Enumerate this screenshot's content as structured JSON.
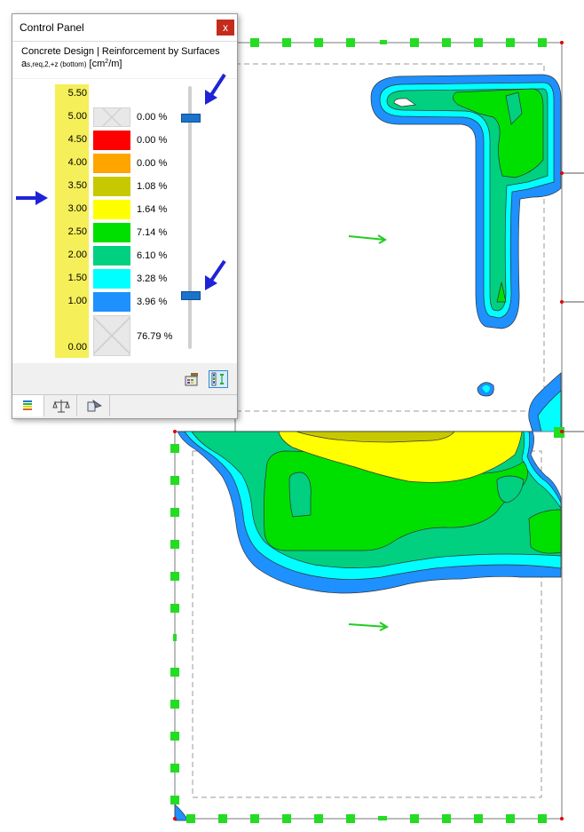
{
  "panel": {
    "title": "Control Panel",
    "close_label": "x",
    "heading": "Concrete Design | Reinforcement by Surfaces",
    "quantity": {
      "symbol": "a",
      "subscript": "s,req,2,+z (bottom)",
      "unit_open": "[cm",
      "unit_sup": "2",
      "unit_close": "/m]"
    },
    "scale_values": [
      "5.50",
      "5.00",
      "4.50",
      "4.00",
      "3.50",
      "3.00",
      "2.50",
      "2.00",
      "1.50",
      "1.00",
      "0.00"
    ],
    "bands": [
      {
        "color": "none",
        "percent": "0.00 %"
      },
      {
        "color": "#ff0000",
        "percent": "0.00 %"
      },
      {
        "color": "#ffa500",
        "percent": "0.00 %"
      },
      {
        "color": "#c8c800",
        "percent": "1.08 %"
      },
      {
        "color": "#ffff00",
        "percent": "1.64 %"
      },
      {
        "color": "#00e000",
        "percent": "7.14 %"
      },
      {
        "color": "#00d080",
        "percent": "6.10 %"
      },
      {
        "color": "#00ffff",
        "percent": "3.28 %"
      },
      {
        "color": "#1e90ff",
        "percent": "3.96 %"
      },
      {
        "color": "none",
        "percent": "76.79 %"
      }
    ],
    "slider": {
      "upper_value": "5.00",
      "lower_value": "1.00"
    },
    "tools": [
      "palette-settings-icon",
      "value-range-icon"
    ],
    "tabs": [
      "color-scale-icon",
      "balance-icon",
      "filter-icon"
    ],
    "active_tab": 0
  },
  "annotations": {
    "arrow_color": "#1f23d6",
    "arrows": [
      "pointer-at-scale",
      "pointer-at-upper-slider",
      "pointer-at-lower-slider"
    ]
  },
  "model": {
    "colors": {
      "light_blue": "#00ffff",
      "blue": "#1e90ff",
      "green": "#00e000",
      "mint": "#00d080",
      "yellow": "#ffff00",
      "olive": "#c8c800",
      "support": "#22dd22",
      "node": "#e00000",
      "edge": "#444444"
    }
  }
}
